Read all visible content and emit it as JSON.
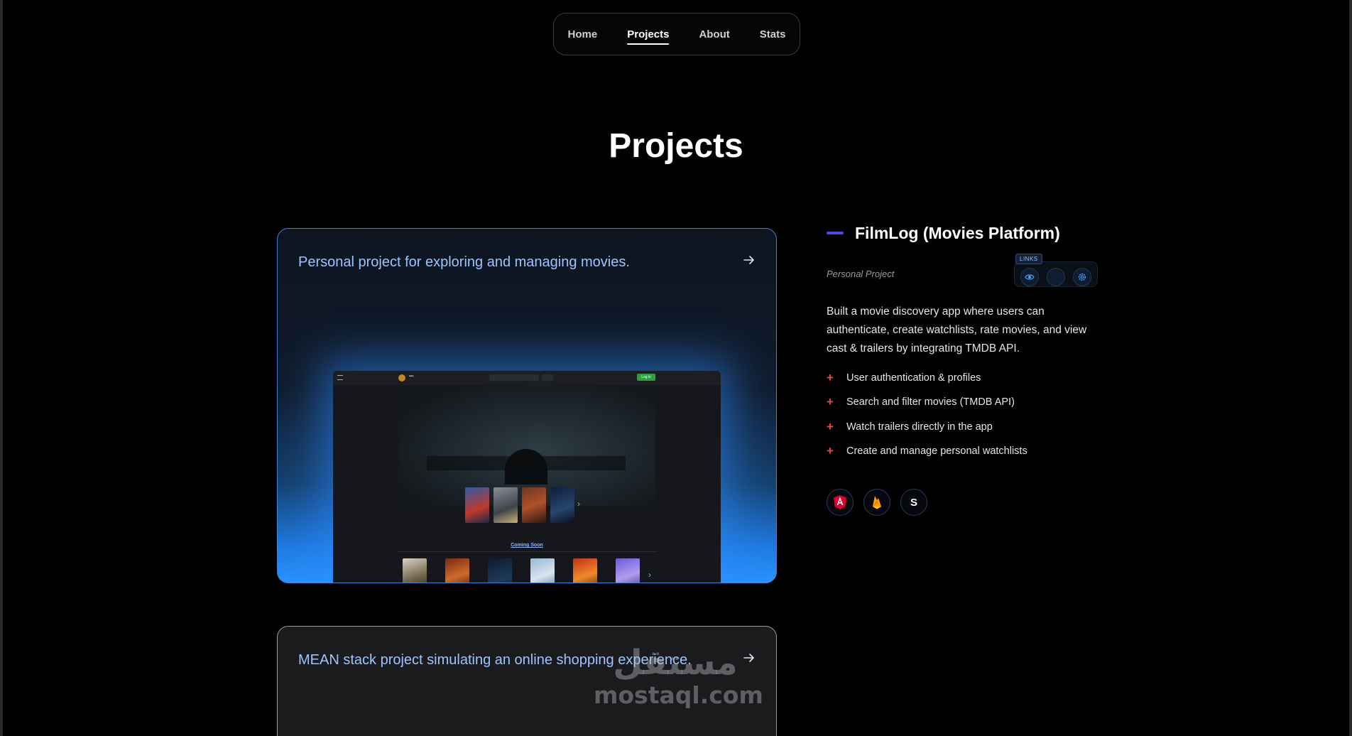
{
  "nav": {
    "items": [
      {
        "label": "Home",
        "active": false
      },
      {
        "label": "Projects",
        "active": true
      },
      {
        "label": "About",
        "active": false
      },
      {
        "label": "Stats",
        "active": false
      }
    ]
  },
  "page": {
    "title": "Projects"
  },
  "cards": [
    {
      "text": "Personal project for exploring and managing movies.",
      "preview": {
        "section_label": "Coming Soon",
        "login_label": "Log in"
      }
    },
    {
      "text": "MEAN stack project simulating an online shopping experience."
    }
  ],
  "project": {
    "title": "FilmLog (Movies Platform)",
    "kind": "Personal Project",
    "links_label": "LINKS",
    "description": "Built a movie discovery app where users can authenticate, create watchlists, rate movies, and view cast & trailers by integrating TMDB API.",
    "features": [
      "User authentication & profiles",
      "Search and filter movies (TMDB API)",
      "Watch trailers directly in the app",
      "Create and manage personal watchlists"
    ],
    "tech": [
      {
        "icon": "angular-icon"
      },
      {
        "icon": "firebase-icon"
      },
      {
        "icon": "s-icon",
        "label": "S"
      }
    ]
  },
  "watermark": {
    "arabic": "مستقل",
    "latin": "mostaql.com"
  },
  "colors": {
    "accent": "#4f46e5",
    "card_border": "#3b82d9",
    "card_glow": "#2b93ff",
    "plus": "#e14a4a"
  }
}
